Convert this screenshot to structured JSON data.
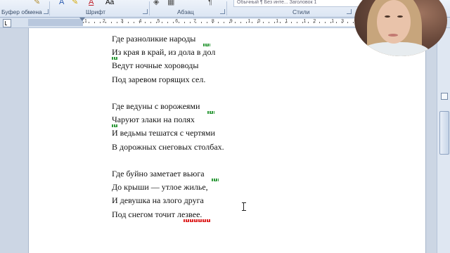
{
  "ribbon": {
    "groups": {
      "clipboard": "Буфер обмена",
      "font": "Шрифт",
      "paragraph": "Абзац",
      "styles": "Стили"
    },
    "font_buttons": {
      "font_glyph": "A",
      "grow_font": "Aa"
    },
    "styles_gallery": "Обычный  ¶ Без инте...  Заголовок 1"
  },
  "ruler": {
    "numbers": "1 2 3 4 5 6 7 8 9 10 11 12 13 14 15 16"
  },
  "document": {
    "lines": [
      "Где разноликие народы",
      "Из края в край, из дола в дол",
      "Ведут ночные хороводы",
      "Под заревом горящих сел.",
      "",
      "Где ведуны с ворожеями",
      "Чаруют злаки на полях",
      "И ведьмы тешатся с чертями",
      "В дорожных снеговых столбах.",
      "",
      "Где буйно заметает вьюга",
      "До крыши — утлое жилье,",
      "И девушка на злого друга",
      "Под снегом точит лезвее."
    ]
  },
  "colors": {
    "ribbon_bg": "#dbe5f3",
    "grammar_underline": "#2f9a3a",
    "spelling_underline": "#d22222",
    "font_color_accent": "#c0202a"
  },
  "icons": [
    "format-painter-icon",
    "highlight-icon",
    "font-color-icon",
    "grow-font-icon",
    "shading-icon",
    "borders-icon",
    "pilcrow-icon",
    "text-cursor-icon"
  ]
}
